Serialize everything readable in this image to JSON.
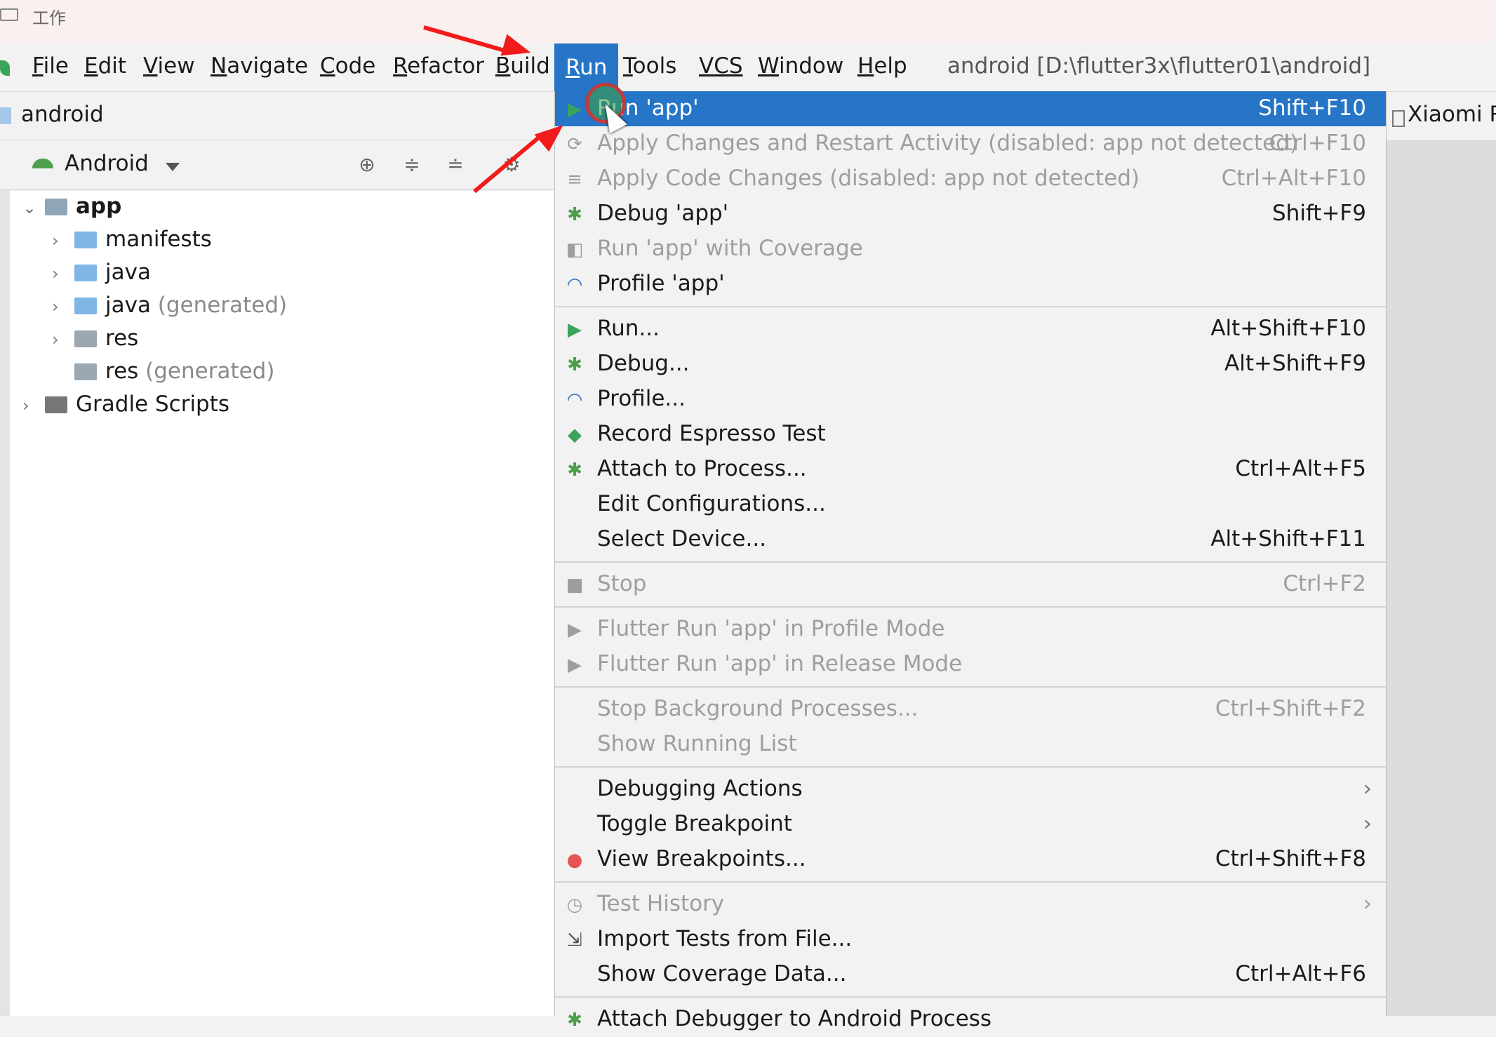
{
  "window": {
    "title": "工作"
  },
  "menubar": {
    "items": [
      {
        "label": "File",
        "ul": "F",
        "rest": "ile"
      },
      {
        "label": "Edit",
        "ul": "E",
        "rest": "dit"
      },
      {
        "label": "View",
        "ul": "V",
        "rest": "iew"
      },
      {
        "label": "Navigate",
        "ul": "N",
        "rest": "avigate"
      },
      {
        "label": "Code",
        "ul": "C",
        "rest": "ode"
      },
      {
        "label": "Refactor",
        "ul": "R",
        "rest": "efactor"
      },
      {
        "label": "Build",
        "ul": "B",
        "rest": "uild"
      },
      {
        "label": "Run",
        "ul": "R",
        "rest": "un"
      },
      {
        "label": "Tools",
        "ul": "T",
        "rest": "ools"
      },
      {
        "label": "VCS",
        "ul": "",
        "rest": "VCS"
      },
      {
        "label": "Window",
        "ul": "W",
        "rest": "indow"
      },
      {
        "label": "Help",
        "ul": "H",
        "rest": "elp"
      }
    ],
    "project_path": "android [D:\\flutter3x\\flutter01\\android]"
  },
  "navbar": {
    "label": "android"
  },
  "right_tab": {
    "label": "Xiaomi R"
  },
  "project_view": {
    "mode": "Android",
    "tree": [
      {
        "label": "app",
        "suffix": "",
        "level": 0,
        "expanded": true
      },
      {
        "label": "manifests",
        "suffix": "",
        "level": 1,
        "expanded": false
      },
      {
        "label": "java",
        "suffix": "",
        "level": 1,
        "expanded": false
      },
      {
        "label": "java",
        "suffix": "(generated)",
        "level": 1,
        "expanded": false
      },
      {
        "label": "res",
        "suffix": "",
        "level": 1,
        "expanded": false
      },
      {
        "label": "res",
        "suffix": "(generated)",
        "level": 1,
        "expanded": null
      },
      {
        "label": "Gradle Scripts",
        "suffix": "",
        "level": 0,
        "expanded": false
      }
    ]
  },
  "run_menu": {
    "items": [
      {
        "label": "Run 'app'",
        "shortcut": "Shift+F10",
        "icon": "run-icon",
        "state": "highlighted"
      },
      {
        "label": "Apply Changes and Restart Activity (disabled: app not detected)",
        "shortcut": "Ctrl+F10",
        "icon": "apply-changes-icon",
        "state": "disabled"
      },
      {
        "label": "Apply Code Changes (disabled: app not detected)",
        "shortcut": "Ctrl+Alt+F10",
        "icon": "apply-code-icon",
        "state": "disabled"
      },
      {
        "label": "Debug 'app'",
        "shortcut": "Shift+F9",
        "icon": "debug-icon",
        "state": "enabled"
      },
      {
        "label": "Run 'app' with Coverage",
        "shortcut": "",
        "icon": "coverage-icon",
        "state": "disabled"
      },
      {
        "label": "Profile 'app'",
        "shortcut": "",
        "icon": "profile-icon",
        "state": "enabled"
      },
      {
        "separator": true
      },
      {
        "label": "Run...",
        "shortcut": "Alt+Shift+F10",
        "icon": "run-icon",
        "state": "enabled"
      },
      {
        "label": "Debug...",
        "shortcut": "Alt+Shift+F9",
        "icon": "debug-icon",
        "state": "enabled"
      },
      {
        "label": "Profile...",
        "shortcut": "",
        "icon": "profile-icon",
        "state": "enabled"
      },
      {
        "label": "Record Espresso Test",
        "shortcut": "",
        "icon": "espresso-icon",
        "state": "enabled"
      },
      {
        "label": "Attach to Process...",
        "shortcut": "Ctrl+Alt+F5",
        "icon": "attach-icon",
        "state": "enabled"
      },
      {
        "label": "Edit Configurations...",
        "shortcut": "",
        "icon": "",
        "state": "enabled"
      },
      {
        "label": "Select Device...",
        "shortcut": "Alt+Shift+F11",
        "icon": "",
        "state": "enabled"
      },
      {
        "separator": true
      },
      {
        "label": "Stop",
        "shortcut": "Ctrl+F2",
        "icon": "stop-icon",
        "state": "disabled"
      },
      {
        "separator": true
      },
      {
        "label": "Flutter Run 'app' in Profile Mode",
        "shortcut": "",
        "icon": "run-icon",
        "state": "disabled"
      },
      {
        "label": "Flutter Run 'app' in Release Mode",
        "shortcut": "",
        "icon": "run-icon",
        "state": "disabled"
      },
      {
        "separator": true
      },
      {
        "label": "Stop Background Processes...",
        "shortcut": "Ctrl+Shift+F2",
        "icon": "",
        "state": "disabled"
      },
      {
        "label": "Show Running List",
        "shortcut": "",
        "icon": "",
        "state": "disabled"
      },
      {
        "separator": true
      },
      {
        "label": "Debugging Actions",
        "shortcut": "",
        "icon": "",
        "state": "enabled",
        "submenu": true
      },
      {
        "label": "Toggle Breakpoint",
        "shortcut": "",
        "icon": "",
        "state": "enabled",
        "submenu": true
      },
      {
        "label": "View Breakpoints...",
        "shortcut": "Ctrl+Shift+F8",
        "icon": "breakpoints-icon",
        "state": "enabled"
      },
      {
        "separator": true
      },
      {
        "label": "Test History",
        "shortcut": "",
        "icon": "clock-icon",
        "state": "disabled",
        "submenu": true
      },
      {
        "label": "Import Tests from File...",
        "shortcut": "",
        "icon": "import-icon",
        "state": "enabled"
      },
      {
        "label": "Show Coverage Data...",
        "shortcut": "Ctrl+Alt+F6",
        "icon": "",
        "state": "enabled"
      },
      {
        "separator": true
      },
      {
        "label": "Attach Debugger to Android Process",
        "shortcut": "",
        "icon": "attach-icon",
        "state": "enabled"
      }
    ]
  },
  "colors": {
    "highlight": "#2675c7",
    "annotation_arrow": "#f21b1b",
    "run_green": "#3aa55a",
    "debug_green": "#4d9e4d",
    "profile_blue": "#2c6fb8",
    "folder_blue": "#7fb6e6",
    "breakpoint_red": "#e55454"
  }
}
